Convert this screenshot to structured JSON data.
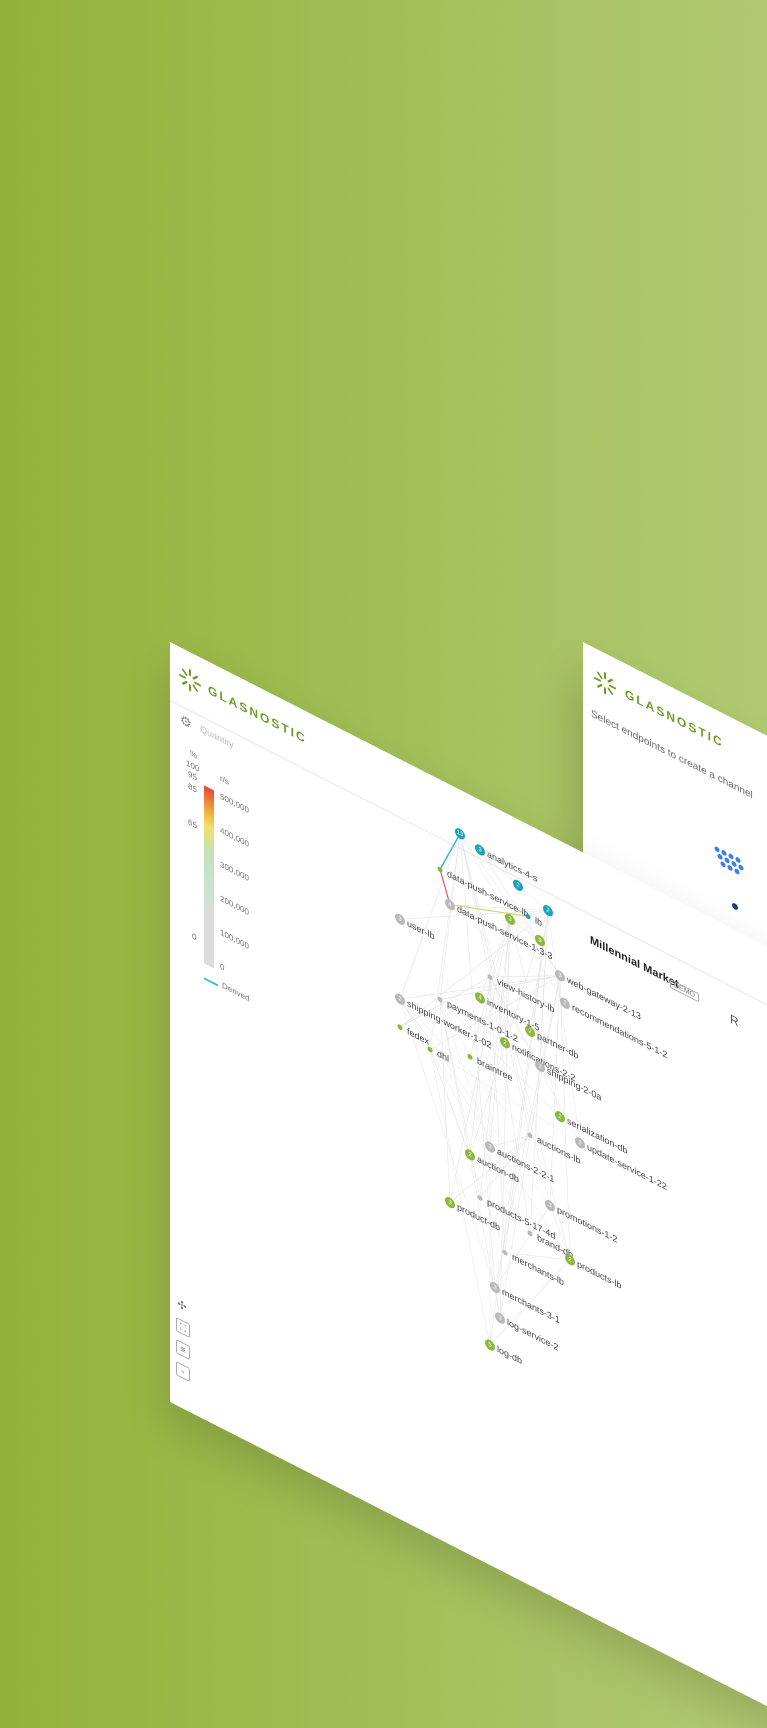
{
  "brand": {
    "name": "GLASNOSTIC",
    "color": "#6a9e2a"
  },
  "back_panel": {
    "hint": "Select endpoints to create a channel"
  },
  "sidebar": {
    "metric_label": "Quantity",
    "legend": {
      "percent_header": "%",
      "rps_header": "r/s",
      "percent_ticks": [
        "100",
        "95",
        "85",
        "65",
        "0"
      ],
      "rps_ticks": [
        "500,000",
        "400,000",
        "300,000",
        "200,000",
        "100,000",
        "0"
      ],
      "derived_label": "Derived"
    }
  },
  "header": {
    "app_title": "Millennial Market",
    "badge": "DEMO",
    "avatar": "R"
  },
  "toolbar": {
    "icons": [
      "graph-icon",
      "frame-select-icon",
      "list-icon",
      "box-icon"
    ]
  },
  "colors": {
    "green": "#8ab83a",
    "gray": "#b8b8b8",
    "teal": "#1aa3b8"
  },
  "nodes": [
    {
      "id": "analytics-4-s",
      "label": "analytics-4-s",
      "count": "3",
      "color": "teal"
    },
    {
      "id": "n13",
      "label": "",
      "count": "13",
      "color": "teal"
    },
    {
      "id": "n2a",
      "label": "",
      "count": "2",
      "color": "teal"
    },
    {
      "id": "n2b",
      "label": "",
      "count": "2",
      "color": "teal"
    },
    {
      "id": "data-push-service-lb",
      "label": "data-push-service-lb",
      "count": "",
      "color": "green"
    },
    {
      "id": "lb",
      "label": "lb",
      "count": "",
      "color": "teal"
    },
    {
      "id": "n3g",
      "label": "",
      "count": "3",
      "color": "green"
    },
    {
      "id": "n9",
      "label": "",
      "count": "9",
      "color": "green"
    },
    {
      "id": "data-push-service-1-3-3",
      "label": "data-push-service-1-3-3",
      "count": "4",
      "color": "gray"
    },
    {
      "id": "web-gateway-2-13",
      "label": "web-gateway-2-13",
      "count": "3",
      "color": "gray"
    },
    {
      "id": "recommendations-5-1-2",
      "label": "recommendations-5-1-2",
      "count": "2",
      "color": "gray"
    },
    {
      "id": "user-lb",
      "label": "user-lb",
      "count": "3",
      "color": "gray"
    },
    {
      "id": "view-history-lb",
      "label": "view-history-lb",
      "count": "",
      "color": "gray"
    },
    {
      "id": "inventory-1-5",
      "label": "inventory-1-5",
      "count": "4",
      "color": "green"
    },
    {
      "id": "partner-db",
      "label": "partner-db",
      "count": "2",
      "color": "green"
    },
    {
      "id": "payments-1-0-1-2",
      "label": "payments-1-0-1-2",
      "count": "",
      "color": "gray"
    },
    {
      "id": "notifications-2-2",
      "label": "notifications-2-2",
      "count": "2",
      "color": "green"
    },
    {
      "id": "shipping-2-0a",
      "label": "shipping-2-0a",
      "count": "2",
      "color": "gray"
    },
    {
      "id": "shipping-worker-1-02",
      "label": "shipping-worker-1-02",
      "count": "2",
      "color": "gray"
    },
    {
      "id": "braintree",
      "label": "braintree",
      "count": "",
      "color": "green"
    },
    {
      "id": "fedex",
      "label": "fedex",
      "count": "",
      "color": "green"
    },
    {
      "id": "dhl",
      "label": "dhl",
      "count": "",
      "color": "green"
    },
    {
      "id": "serialization-db",
      "label": "serialization-db",
      "count": "2",
      "color": "green"
    },
    {
      "id": "update-service-1-22",
      "label": "update-service-1-22",
      "count": "3",
      "color": "gray"
    },
    {
      "id": "auctions-lb",
      "label": "auctions-lb",
      "count": "",
      "color": "gray"
    },
    {
      "id": "auctions-2-2-1",
      "label": "auctions-2-2-1",
      "count": "3",
      "color": "gray"
    },
    {
      "id": "auction-db",
      "label": "auction-db",
      "count": "2",
      "color": "green"
    },
    {
      "id": "promotions-1-2",
      "label": "promotions-1-2",
      "count": "3",
      "color": "gray"
    },
    {
      "id": "products-5-17-4d",
      "label": "products-5-17-4d",
      "count": "",
      "color": "gray"
    },
    {
      "id": "brand-db",
      "label": "brand-db",
      "count": "",
      "color": "gray"
    },
    {
      "id": "products-lb",
      "label": "products-lb",
      "count": "2",
      "color": "green"
    },
    {
      "id": "product-db",
      "label": "product-db",
      "count": "3",
      "color": "green"
    },
    {
      "id": "merchants-lb",
      "label": "merchants-lb",
      "count": "",
      "color": "gray"
    },
    {
      "id": "merchants-3-1",
      "label": "merchants-3-1",
      "count": "3",
      "color": "gray"
    },
    {
      "id": "log-service-2",
      "label": "log-service-2",
      "count": "3",
      "color": "gray"
    },
    {
      "id": "log-db",
      "label": "log-db",
      "count": "5",
      "color": "green"
    }
  ]
}
